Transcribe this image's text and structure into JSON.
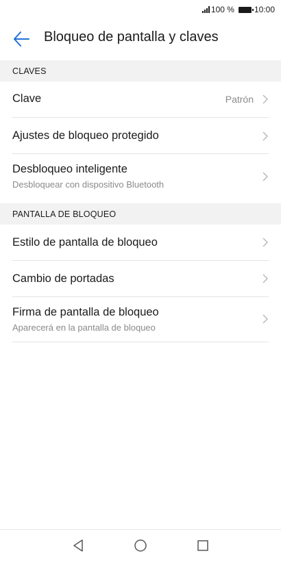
{
  "status_bar": {
    "battery_text": "100 %",
    "time": "10:00",
    "signal_icon": "signal-icon",
    "battery_icon": "battery-icon"
  },
  "app_bar": {
    "title": "Bloqueo de pantalla y claves",
    "back_icon": "arrow-left-icon"
  },
  "sections": [
    {
      "header": "CLAVES",
      "items": [
        {
          "title": "Clave",
          "value": "Patrón"
        },
        {
          "title": "Ajustes de bloqueo protegido"
        },
        {
          "title": "Desbloqueo inteligente",
          "subtitle": "Desbloquear con dispositivo Bluetooth"
        }
      ]
    },
    {
      "header": "PANTALLA DE BLOQUEO",
      "items": [
        {
          "title": "Estilo de pantalla de bloqueo"
        },
        {
          "title": "Cambio de portadas"
        },
        {
          "title": "Firma de pantalla de bloqueo",
          "subtitle": "Aparecerá en la pantalla de bloqueo"
        }
      ]
    }
  ],
  "nav_bar": {
    "back_icon": "nav-back-triangle-icon",
    "home_icon": "nav-home-circle-icon",
    "recents_icon": "nav-recents-square-icon"
  },
  "colors": {
    "accent": "#1f6fd6",
    "section_bg": "#f2f2f2",
    "secondary_text": "#8a8a8a",
    "divider": "#e2e2e2"
  }
}
